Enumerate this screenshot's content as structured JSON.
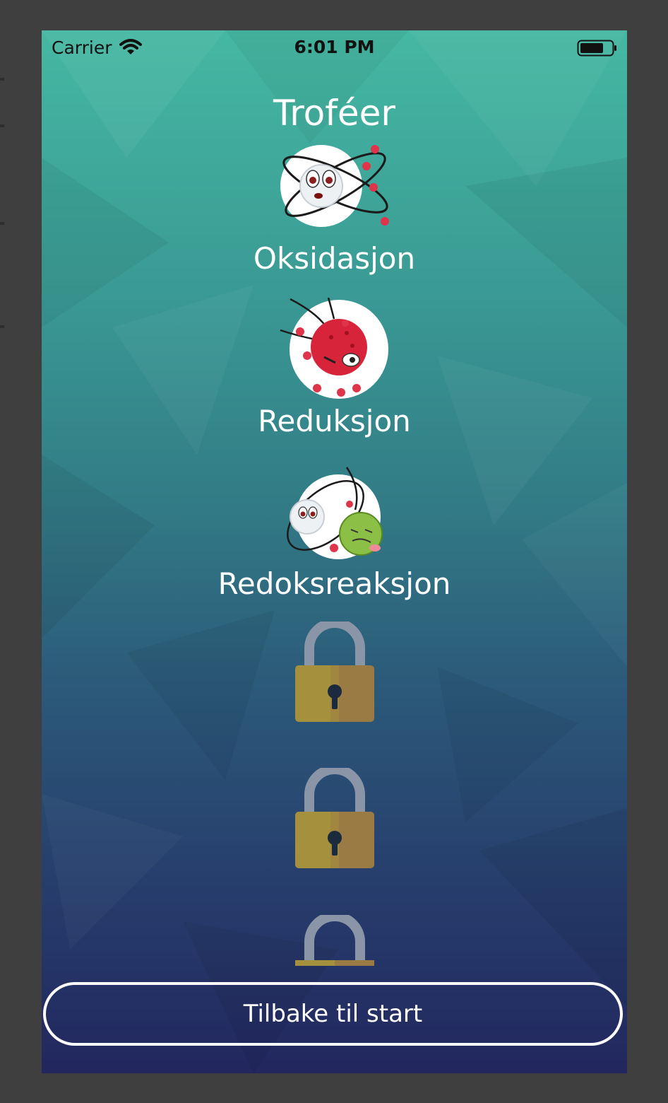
{
  "status_bar": {
    "carrier": "Carrier",
    "time": "6:01 PM",
    "wifi_icon": "wifi-icon",
    "battery_icon": "battery-icon"
  },
  "page": {
    "title": "Troféer"
  },
  "trophies": [
    {
      "label": "Oksidasjon",
      "unlocked": true,
      "icon": "oxidation-molecule-icon"
    },
    {
      "label": "Reduksjon",
      "unlocked": true,
      "icon": "reduction-molecule-icon"
    },
    {
      "label": "Redoksreaksjon",
      "unlocked": true,
      "icon": "redox-molecules-icon"
    },
    {
      "label": "",
      "unlocked": false,
      "icon": "padlock-icon"
    },
    {
      "label": "",
      "unlocked": false,
      "icon": "padlock-icon"
    },
    {
      "label": "",
      "unlocked": false,
      "icon": "padlock-icon"
    }
  ],
  "footer": {
    "back_button_label": "Tilbake til start"
  },
  "colors": {
    "gradient_top": "#45b8a2",
    "gradient_bottom": "#22275e",
    "lock_body": "#a5903e",
    "lock_shackle": "#8a96a8"
  }
}
